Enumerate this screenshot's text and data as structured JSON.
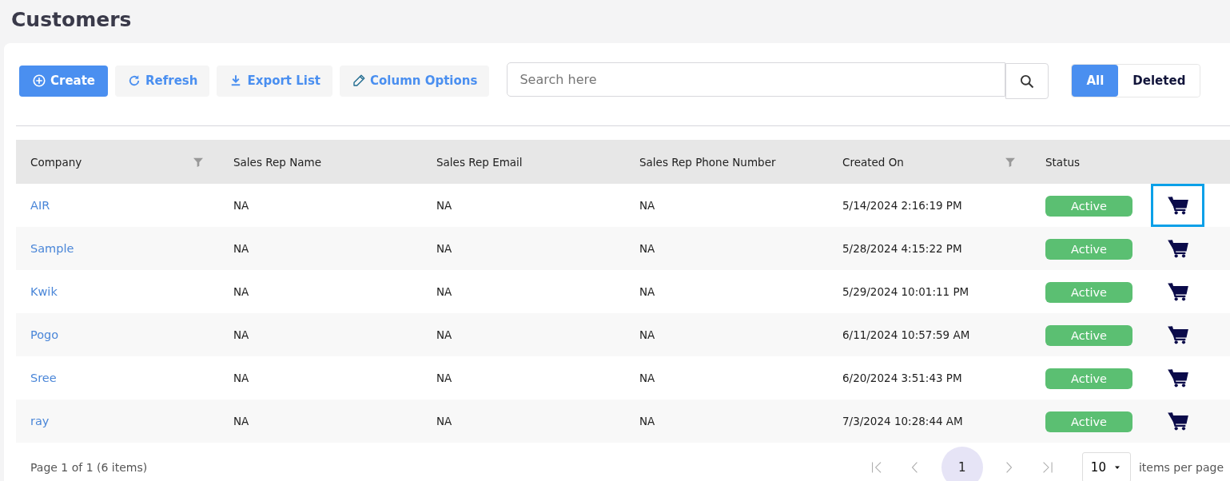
{
  "page_title": "Customers",
  "toolbar": {
    "buttons": [
      {
        "kind": "create",
        "label": "Create"
      },
      {
        "kind": "refresh",
        "label": "Refresh"
      },
      {
        "kind": "export",
        "label": "Export List"
      },
      {
        "kind": "columns",
        "label": "Column Options"
      }
    ],
    "search": {
      "placeholder": "Search here"
    },
    "filter_toggle": [
      {
        "label": "All",
        "selected": true
      },
      {
        "label": "Deleted",
        "selected": false
      }
    ]
  },
  "table": {
    "columns": [
      {
        "label": "Company",
        "filterable": true
      },
      {
        "label": "Sales Rep Name",
        "filterable": false
      },
      {
        "label": "Sales Rep Email",
        "filterable": false
      },
      {
        "label": "Sales Rep Phone Number",
        "filterable": false
      },
      {
        "label": "Created On",
        "filterable": true
      },
      {
        "label": "Status",
        "filterable": false
      }
    ],
    "rows": [
      {
        "company": "AIR",
        "rep_name": "NA",
        "rep_email": "NA",
        "rep_phone": "NA",
        "created_on": "5/14/2024 2:16:19 PM",
        "status": "Active",
        "cart_focused": true
      },
      {
        "company": "Sample",
        "rep_name": "NA",
        "rep_email": "NA",
        "rep_phone": "NA",
        "created_on": "5/28/2024 4:15:22 PM",
        "status": "Active",
        "cart_focused": false
      },
      {
        "company": "Kwik",
        "rep_name": "NA",
        "rep_email": "NA",
        "rep_phone": "NA",
        "created_on": "5/29/2024 10:01:11 PM",
        "status": "Active",
        "cart_focused": false
      },
      {
        "company": "Pogo",
        "rep_name": "NA",
        "rep_email": "NA",
        "rep_phone": "NA",
        "created_on": "6/11/2024 10:57:59 AM",
        "status": "Active",
        "cart_focused": false
      },
      {
        "company": "Sree",
        "rep_name": "NA",
        "rep_email": "NA",
        "rep_phone": "NA",
        "created_on": "6/20/2024 3:51:43 PM",
        "status": "Active",
        "cart_focused": false
      },
      {
        "company": "ray",
        "rep_name": "NA",
        "rep_email": "NA",
        "rep_phone": "NA",
        "created_on": "7/3/2024 10:28:44 AM",
        "status": "Active",
        "cart_focused": false
      }
    ]
  },
  "pager": {
    "summary": "Page 1 of 1 (6 items)",
    "pages": [
      {
        "label": "1",
        "selected": true
      }
    ],
    "page_size": "10",
    "page_size_label": "items per page"
  }
}
